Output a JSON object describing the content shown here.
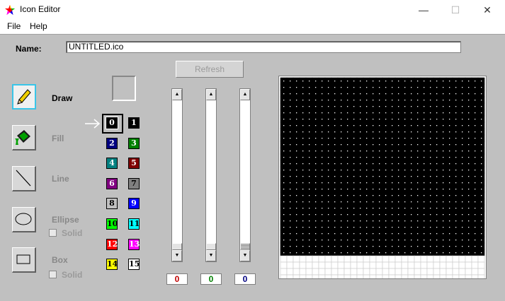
{
  "window": {
    "title": "Icon Editor",
    "minimize": "—",
    "maximize": "☐",
    "close": "✕"
  },
  "menu": [
    {
      "label": "File"
    },
    {
      "label": "Help"
    }
  ],
  "name_field": {
    "label": "Name:",
    "value": "UNTITLED.ico"
  },
  "refresh_label": "Refresh",
  "tools": {
    "draw": {
      "label": "Draw",
      "icon": "pencil-icon"
    },
    "fill": {
      "label": "Fill",
      "icon": "paint-bucket-icon"
    },
    "line": {
      "label": "Line",
      "icon": "line-icon"
    },
    "ellipse": {
      "label": "Ellipse",
      "icon": "ellipse-icon",
      "solid_label": "Solid"
    },
    "box": {
      "label": "Box",
      "icon": "rectangle-icon",
      "solid_label": "Solid"
    }
  },
  "palette": {
    "selected_index": 0,
    "colors": [
      {
        "n": "0",
        "bg": "#000000",
        "fg": "#ffffff"
      },
      {
        "n": "1",
        "bg": "#000000",
        "fg": "#ffffff"
      },
      {
        "n": "2",
        "bg": "#000080",
        "fg": "#ffffff"
      },
      {
        "n": "3",
        "bg": "#008000",
        "fg": "#ffffff"
      },
      {
        "n": "4",
        "bg": "#008080",
        "fg": "#ffffff"
      },
      {
        "n": "5",
        "bg": "#800000",
        "fg": "#ffffff"
      },
      {
        "n": "6",
        "bg": "#800080",
        "fg": "#ffffff"
      },
      {
        "n": "7",
        "bg": "#808080",
        "fg": "#000000"
      },
      {
        "n": "8",
        "bg": "#c0c0c0",
        "fg": "#000000"
      },
      {
        "n": "9",
        "bg": "#0000ff",
        "fg": "#ffffff"
      },
      {
        "n": "10",
        "bg": "#00ff00",
        "fg": "#000000"
      },
      {
        "n": "11",
        "bg": "#00ffff",
        "fg": "#000000"
      },
      {
        "n": "12",
        "bg": "#ff0000",
        "fg": "#ffffff"
      },
      {
        "n": "13",
        "bg": "#ff00ff",
        "fg": "#ffffff"
      },
      {
        "n": "14",
        "bg": "#ffff00",
        "fg": "#000000"
      },
      {
        "n": "15",
        "bg": "#ffffff",
        "fg": "#000000"
      }
    ]
  },
  "sliders": [
    {
      "name": "red",
      "value": "0",
      "color": "#c00000"
    },
    {
      "name": "green",
      "value": "0",
      "color": "#008000"
    },
    {
      "name": "blue",
      "value": "0",
      "color": "#000080"
    }
  ],
  "icon_grid": {
    "cols": 32,
    "rows": 32,
    "filled_rows": 28,
    "fill_color": "#000000",
    "dot_color": "#ffffff",
    "empty_color": "#ffffff",
    "line_color": "#c8c8c8"
  }
}
